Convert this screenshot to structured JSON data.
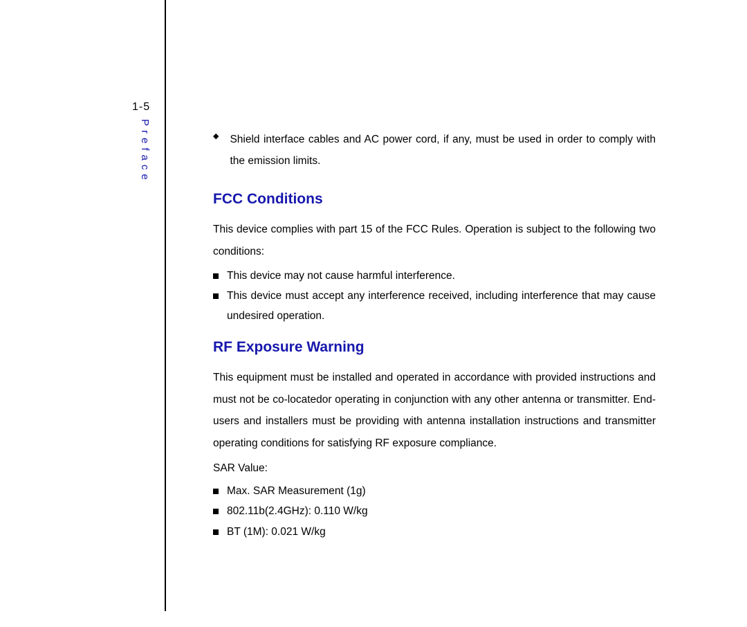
{
  "page_number": "1-5",
  "vertical_label": "Preface",
  "intro_bullet": "Shield interface cables and AC power cord, if any, must be used in order to comply with the emission limits.",
  "fcc": {
    "heading": "FCC Conditions",
    "intro": "This device complies with part 15 of the FCC Rules.   Operation is subject to the following two conditions:",
    "bullets": [
      "This device may not cause harmful interference.",
      "This device must accept any interference received, including interference that may cause undesired operation."
    ]
  },
  "rf": {
    "heading": "RF Exposure Warning",
    "paragraph": "This equipment must be installed and operated in accordance with provided instructions and must not be co-locatedor operating in conjunction with any other antenna or transmitter. End-users and installers must be providing with antenna installation instructions and transmitter operating conditions for satisfying RF exposure compliance.",
    "sar_label": "SAR Value:",
    "sar_items": [
      "Max. SAR Measurement (1g)",
      "802.11b(2.4GHz): 0.110 W/kg",
      "BT (1M): 0.021 W/kg"
    ]
  }
}
